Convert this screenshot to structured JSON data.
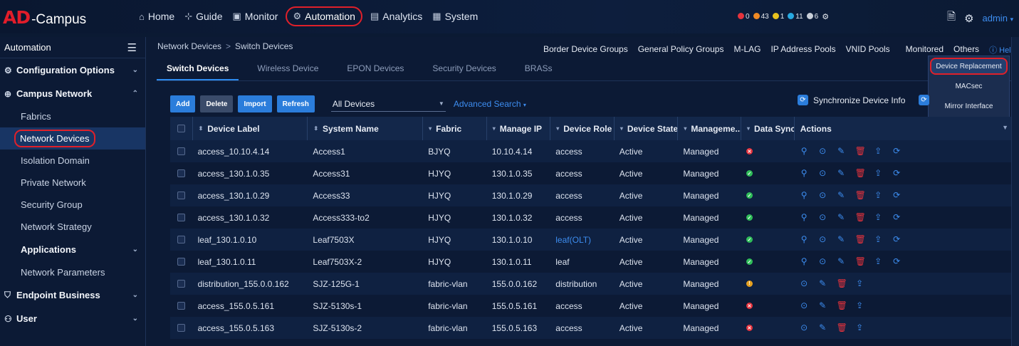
{
  "logo": {
    "ad": "AD",
    "rest": "-Campus"
  },
  "topnav": [
    {
      "label": "Home",
      "icon": "home-icon",
      "glyph": "⌂"
    },
    {
      "label": "Guide",
      "icon": "guide-icon",
      "glyph": "⊹"
    },
    {
      "label": "Monitor",
      "icon": "monitor-icon",
      "glyph": "▣"
    },
    {
      "label": "Automation",
      "icon": "automation-icon",
      "glyph": "⚙",
      "active": true
    },
    {
      "label": "Analytics",
      "icon": "analytics-icon",
      "glyph": "▤"
    },
    {
      "label": "System",
      "icon": "system-icon",
      "glyph": "▦"
    }
  ],
  "alarms": [
    {
      "count": "0",
      "color": "#e5333d"
    },
    {
      "count": "43",
      "color": "#f08a24"
    },
    {
      "count": "1",
      "color": "#e8c21e"
    },
    {
      "count": "11",
      "color": "#27a9e1"
    },
    {
      "count": "6",
      "color": "#c8ced8"
    }
  ],
  "user": {
    "name": "admin"
  },
  "sidebar": {
    "title": "Automation",
    "configuration_options": "Configuration Options",
    "campus_network": "Campus Network",
    "items": [
      "Fabrics",
      "Network Devices",
      "Isolation Domain",
      "Private Network",
      "Security Group",
      "Network Strategy"
    ],
    "applications": "Applications",
    "network_parameters": "Network Parameters",
    "endpoint_business": "Endpoint Business",
    "user": "User"
  },
  "breadcrumb": {
    "parent": "Network Devices",
    "current": "Switch Devices"
  },
  "quicklinks": [
    "Border Device Groups",
    "General Policy Groups",
    "M-LAG",
    "IP Address Pools",
    "VNID Pools",
    "Monitored",
    "Others"
  ],
  "help": "Help",
  "tabs": [
    "Switch Devices",
    "Wireless Device",
    "EPON Devices",
    "Security Devices",
    "BRASs"
  ],
  "others_menu": [
    "Device Replacement",
    "MACsec",
    "Mirror Interface"
  ],
  "toolbar": {
    "add": "Add",
    "delete": "Delete",
    "import": "Import",
    "refresh": "Refresh",
    "filter": "All Devices",
    "advanced_search": "Advanced Search",
    "sync": "Synchronize Device Info"
  },
  "columns": [
    "Device Label",
    "System Name",
    "Fabric",
    "Manage IP",
    "Device Role",
    "Device State",
    "Manageme...",
    "Data Sync...",
    "Actions"
  ],
  "rows": [
    {
      "label": "access_10.10.4.14",
      "system": "Access1",
      "fabric": "BJYQ",
      "ip": "10.10.4.14",
      "role": "access",
      "state": "Active",
      "mgmt": "Managed",
      "sync": "error",
      "actions": 6
    },
    {
      "label": "access_130.1.0.35",
      "system": "Access31",
      "fabric": "HJYQ",
      "ip": "130.1.0.35",
      "role": "access",
      "state": "Active",
      "mgmt": "Managed",
      "sync": "ok",
      "actions": 6
    },
    {
      "label": "access_130.1.0.29",
      "system": "Access33",
      "fabric": "HJYQ",
      "ip": "130.1.0.29",
      "role": "access",
      "state": "Active",
      "mgmt": "Managed",
      "sync": "ok",
      "actions": 6
    },
    {
      "label": "access_130.1.0.32",
      "system": "Access333-to2",
      "fabric": "HJYQ",
      "ip": "130.1.0.32",
      "role": "access",
      "state": "Active",
      "mgmt": "Managed",
      "sync": "ok",
      "actions": 6
    },
    {
      "label": "leaf_130.1.0.10",
      "system": "Leaf7503X",
      "fabric": "HJYQ",
      "ip": "130.1.0.10",
      "role": "leaf(OLT)",
      "state": "Active",
      "mgmt": "Managed",
      "sync": "ok",
      "actions": 6,
      "role_link": true
    },
    {
      "label": "leaf_130.1.0.11",
      "system": "Leaf7503X-2",
      "fabric": "HJYQ",
      "ip": "130.1.0.11",
      "role": "leaf",
      "state": "Active",
      "mgmt": "Managed",
      "sync": "ok",
      "actions": 6
    },
    {
      "label": "distribution_155.0.0.162",
      "system": "SJZ-125G-1",
      "fabric": "fabric-vlan",
      "ip": "155.0.0.162",
      "role": "distribution",
      "state": "Active",
      "mgmt": "Managed",
      "sync": "warn",
      "actions": 4
    },
    {
      "label": "access_155.0.5.161",
      "system": "SJZ-5130s-1",
      "fabric": "fabric-vlan",
      "ip": "155.0.5.161",
      "role": "access",
      "state": "Active",
      "mgmt": "Managed",
      "sync": "error",
      "actions": 4
    },
    {
      "label": "access_155.0.5.163",
      "system": "SJZ-5130s-2",
      "fabric": "fabric-vlan",
      "ip": "155.0.5.163",
      "role": "access",
      "state": "Active",
      "mgmt": "Managed",
      "sync": "error",
      "actions": 4
    }
  ]
}
